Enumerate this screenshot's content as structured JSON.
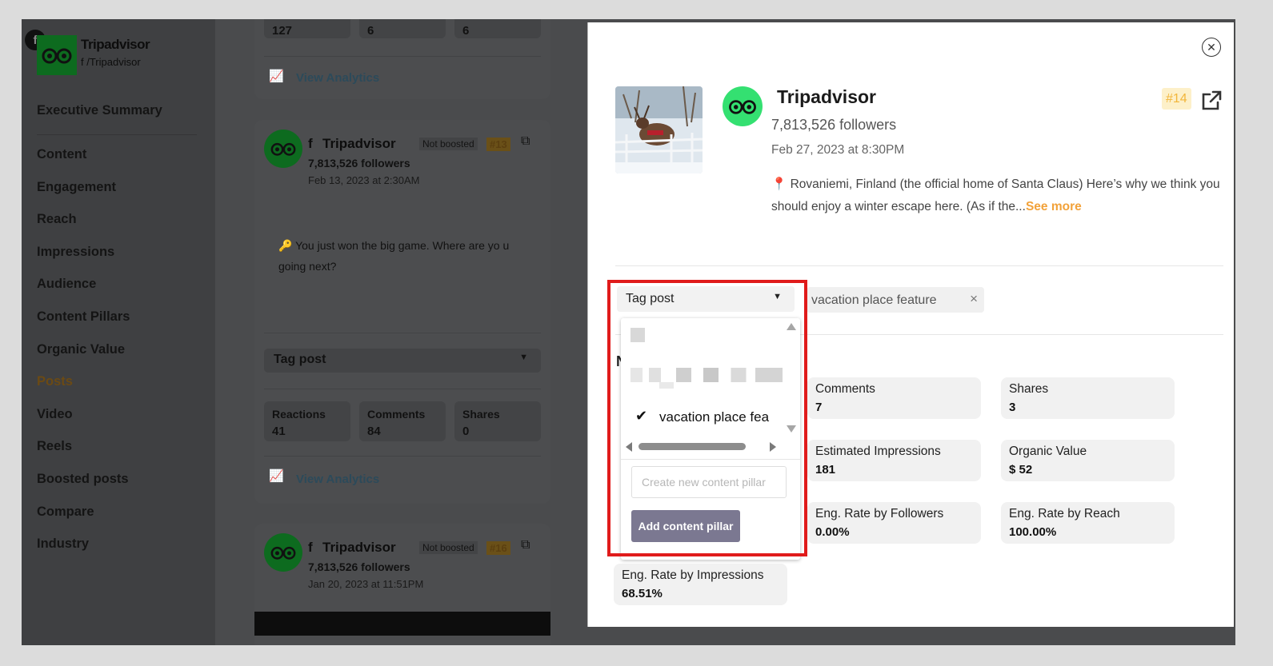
{
  "sidebar": {
    "platform_badge": "f",
    "brand_name": "Tripadvisor",
    "brand_handle": "f /Tripadvisor",
    "nav": [
      "Executive Summary",
      "Content",
      "Engagement",
      "Reach",
      "Impressions",
      "Audience",
      "Content Pillars",
      "Organic Value",
      "Posts",
      "Video",
      "Reels",
      "Boosted posts",
      "Compare",
      "Industry"
    ],
    "active_item": "Posts"
  },
  "feed": {
    "top_stats": [
      "127",
      "6",
      "6"
    ],
    "view_analytics": "View Analytics",
    "posts": [
      {
        "name": "Tripadvisor",
        "status": "Not boosted",
        "rank": "#13",
        "followers": "7,813,526 followers",
        "date": "Feb 13, 2023 at 2:30AM",
        "text": "🔑 You just won the big game. Where are yo u going next?",
        "tag_label": "Tag post",
        "stats": [
          {
            "label": "Reactions",
            "value": "41"
          },
          {
            "label": "Comments",
            "value": "84"
          },
          {
            "label": "Shares",
            "value": "0"
          }
        ]
      },
      {
        "name": "Tripadvisor",
        "status": "Not boosted",
        "rank": "#16",
        "followers": "7,813,526 followers",
        "date": "Jan 20, 2023 at 11:51PM"
      }
    ]
  },
  "modal": {
    "page_name": "Tripadvisor",
    "followers": "7,813,526 followers",
    "date": "Feb 27, 2023 at 8:30PM",
    "rank": "#14",
    "text": "📍 Rovaniemi, Finland (the official home of Santa Claus) Here’s why we think you should enjoy a winter escape here. (As if the...",
    "see_more": "See more",
    "tag_select_label": "Tag post",
    "selected_tag": "vacation place feature",
    "dropdown": {
      "option_label": "vacation place fea",
      "input_placeholder": "Create new content pillar",
      "add_button": "Add content pillar"
    },
    "metrics_title_initial": "N",
    "metrics": [
      {
        "label": "Comments",
        "value": "7"
      },
      {
        "label": "Shares",
        "value": "3"
      },
      {
        "label": "Estimated Impressions",
        "value": "181"
      },
      {
        "label": "Organic Value",
        "value": "$ 52"
      },
      {
        "label": "Eng. Rate by Followers",
        "value": "0.00%"
      },
      {
        "label": "Eng. Rate by Reach",
        "value": "100.00%"
      },
      {
        "label": "Eng. Rate by Impressions",
        "value": "68.51%"
      }
    ]
  },
  "colors": {
    "accent_orange": "#f2a23a",
    "rank_badge_bg": "#fdf0c9",
    "brand_green": "#34e071",
    "button_purple": "#7b7891",
    "highlight_red": "#e01b1b"
  }
}
